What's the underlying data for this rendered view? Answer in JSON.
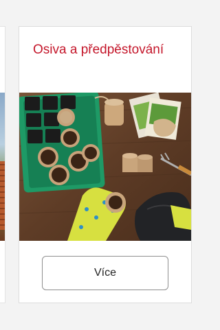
{
  "card": {
    "title": "Osiva a předpěstování",
    "image_alt": "Sadbovač se sazenicemi, rašelinové květináče, zahradnické rukavice a sáčky semínek na dřevěném stole",
    "button_label": "Více"
  },
  "colors": {
    "title": "#c4162a",
    "background": "#f3f3f3",
    "card_border": "#dcdcdc",
    "button_border": "#8e8e8e"
  }
}
